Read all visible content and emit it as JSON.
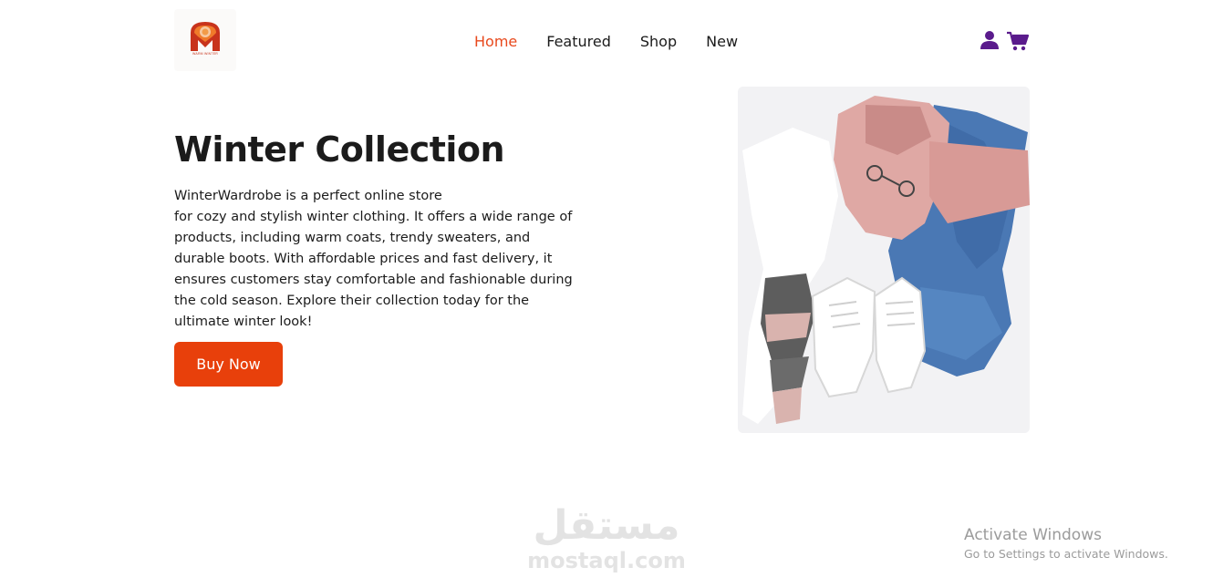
{
  "brand": {
    "logo_text": "WARM WINTER",
    "icon": "orange-shield-logo-icon"
  },
  "nav": {
    "items": [
      {
        "label": "Home",
        "active": true
      },
      {
        "label": "Featured",
        "active": false
      },
      {
        "label": "Shop",
        "active": false
      },
      {
        "label": "New",
        "active": false
      }
    ]
  },
  "header_icons": {
    "user": "user-icon",
    "cart": "cart-icon"
  },
  "hero": {
    "title": "Winter Collection",
    "description_lines": [
      "WinterWardrobe is a perfect online store",
      "for cozy and stylish winter clothing. It offers a wide range of",
      "products, including warm coats, trendy sweaters, and",
      "durable boots. With affordable prices and fast delivery, it",
      "ensures customers stay comfortable and fashionable during",
      "the cold season. Explore their collection today for the",
      "ultimate winter look!"
    ],
    "button_label": "Buy Now"
  },
  "watermark": {
    "arabic": "مستقل",
    "latin": "mostaql.com"
  },
  "os_overlay": {
    "title": "Activate Windows",
    "subtitle": "Go to Settings to activate Windows."
  },
  "colors": {
    "accent": "#e8400b",
    "nav_active": "#e8491d",
    "icon_purple": "#5a1b8c",
    "text": "#1b1b1b"
  }
}
